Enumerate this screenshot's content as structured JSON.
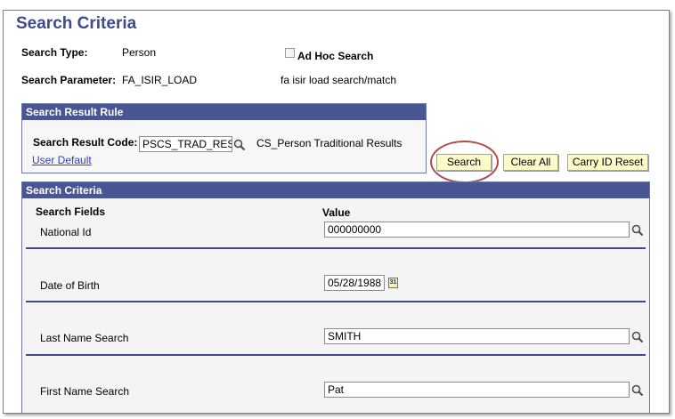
{
  "title": "Search Criteria",
  "search_type": {
    "label": "Search Type:",
    "value": "Person"
  },
  "ad_hoc": {
    "label": "Ad Hoc Search",
    "checked": false
  },
  "search_parameter": {
    "label": "Search Parameter:",
    "value": "FA_ISIR_LOAD",
    "description": "fa isir load search/match"
  },
  "result_rule": {
    "header": "Search Result Rule",
    "code_label": "Search Result Code:",
    "code_value": "PSCS_TRAD_RES",
    "code_description": "CS_Person Traditional Results",
    "user_default_link": "User Default"
  },
  "buttons": {
    "search": "Search",
    "clear_all": "Clear All",
    "carry_id_reset": "Carry ID Reset"
  },
  "criteria": {
    "header": "Search Criteria",
    "col_fields": "Search Fields",
    "col_value": "Value",
    "fields": [
      {
        "label": "National Id",
        "value": "000000000"
      },
      {
        "label": "Date of Birth",
        "value": "05/28/1988",
        "calendar_icon": "31"
      },
      {
        "label": "Last Name Search",
        "value": "SMITH"
      },
      {
        "label": "First Name Search",
        "value": "Pat"
      }
    ]
  },
  "colors": {
    "header_bg": "#4a5694",
    "title": "#3f4b8a",
    "button_bg": "#fdfbc9",
    "highlight_circle": "#b24a4a"
  }
}
